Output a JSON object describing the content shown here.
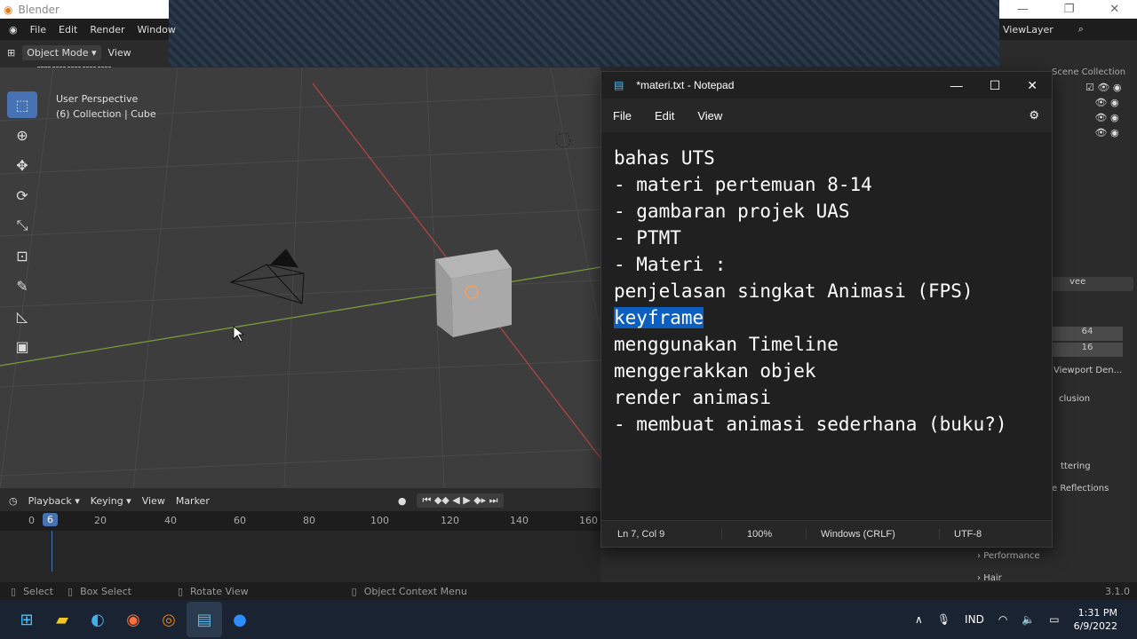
{
  "blender": {
    "title": "Blender",
    "menu": [
      "File",
      "Edit",
      "Render",
      "Window"
    ],
    "mode": "Object Mode",
    "view": "View",
    "viewlayer": "ViewLayer",
    "viewport_info": [
      "User Perspective",
      "(6) Collection | Cube"
    ],
    "timeline": {
      "playback": "Playback",
      "keying": "Keying",
      "view": "View",
      "marker": "Marker",
      "current_frame": "6",
      "ticks": [
        "0",
        "20",
        "40",
        "60",
        "80",
        "100",
        "120",
        "140",
        "160"
      ]
    },
    "status": {
      "select": "Select",
      "box_select": "Box Select",
      "rotate_view": "Rotate View",
      "context_menu": "Object Context Menu",
      "version": "3.1.0"
    },
    "outliner_label": "Scene Collection",
    "props": [
      "vee",
      "64",
      "16",
      "Viewport Den...",
      "clusion",
      "ttering",
      "e Reflections",
      "Performance",
      "Hair"
    ]
  },
  "notepad": {
    "title": "*materi.txt - Notepad",
    "menu": [
      "File",
      "Edit",
      "View"
    ],
    "lines": [
      "bahas UTS",
      "- materi pertemuan 8-14",
      "- gambaran projek UAS",
      "- PTMT",
      "- Materi :",
      "penjelasan singkat Animasi (FPS)",
      "keyframe",
      "menggunakan Timeline",
      "menggerakkan objek",
      "render animasi",
      "- membuat animasi sederhana (buku?)"
    ],
    "status": {
      "pos": "Ln 7, Col 9",
      "zoom": "100%",
      "eol": "Windows (CRLF)",
      "enc": "UTF-8"
    }
  },
  "taskbar": {
    "lang": "IND",
    "time": "1:31 PM",
    "date": "6/9/2022"
  },
  "colors": {
    "accent": "#4772b3",
    "highlight": "#0c5fbe"
  }
}
